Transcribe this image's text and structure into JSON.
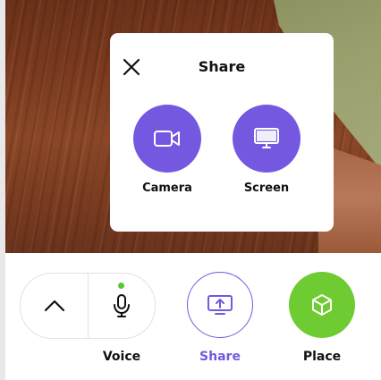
{
  "share_panel": {
    "title": "Share",
    "options": [
      {
        "label": "Camera",
        "icon": "video-camera-icon"
      },
      {
        "label": "Screen",
        "icon": "monitor-icon"
      }
    ]
  },
  "toolbar": {
    "voice_label": "Voice",
    "share_label": "Share",
    "place_label": "Place",
    "mic_status": "active"
  },
  "colors": {
    "accent": "#7458e0",
    "place": "#6fcb32",
    "mic_active": "#5cc63a",
    "text": "#111111"
  }
}
